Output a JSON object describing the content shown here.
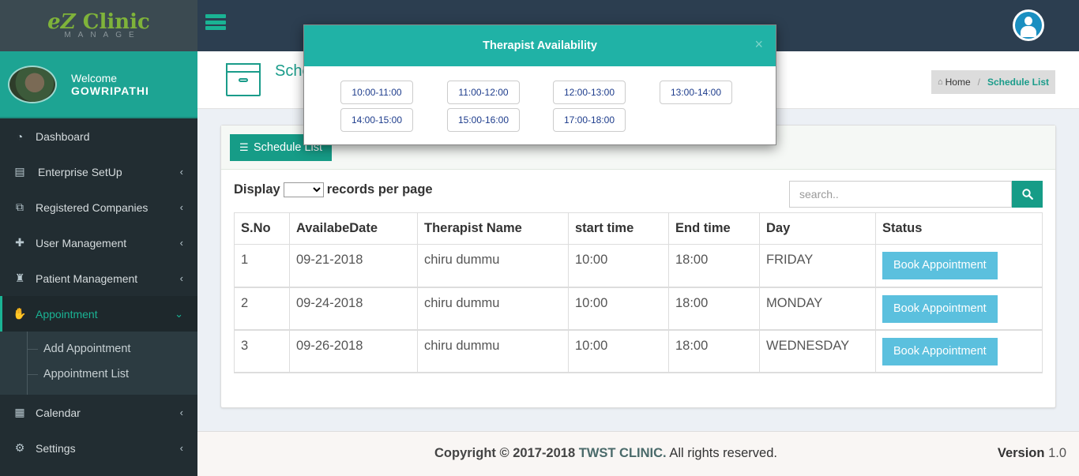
{
  "logo": {
    "name_prefix": "eZ",
    "name_suffix": " Clinic",
    "subtitle": "MANAGE"
  },
  "user_panel": {
    "welcome": "Welcome",
    "username": "GOWRIPATHI"
  },
  "sidebar": {
    "items": [
      {
        "label": "Dashboard",
        "icon": "dashboard-icon",
        "arrow": ""
      },
      {
        "label": "Enterprise SetUp",
        "icon": "clipboard-icon",
        "arrow": "‹"
      },
      {
        "label": "Registered Companies",
        "icon": "sitemap-icon",
        "arrow": "‹"
      },
      {
        "label": "User Management",
        "icon": "user-plus-icon",
        "arrow": "‹"
      },
      {
        "label": "Patient Management",
        "icon": "patient-icon",
        "arrow": "‹"
      },
      {
        "label": "Appointment",
        "icon": "handshake-icon",
        "arrow": "⌄"
      },
      {
        "label": "Calendar",
        "icon": "calendar-icon",
        "arrow": "‹"
      },
      {
        "label": "Settings",
        "icon": "gear-icon",
        "arrow": "‹"
      }
    ],
    "submenu": [
      "Add Appointment",
      "Appointment List"
    ]
  },
  "header": {
    "title": "Schedule List",
    "title_visible": "Sche"
  },
  "breadcrumb": {
    "home": "Home",
    "current": "Schedule List"
  },
  "panel": {
    "button_label": "Schedule List",
    "display_label": "Display",
    "records_label": "records per page",
    "search_placeholder": "search.."
  },
  "table": {
    "columns": [
      "S.No",
      "AvailabeDate",
      "Therapist Name",
      "start time",
      "End time",
      "Day",
      "Status"
    ],
    "rows": [
      {
        "sno": "1",
        "date": "09-21-2018",
        "therapist": "chiru dummu",
        "start": "10:00",
        "end": "18:00",
        "day": "FRIDAY",
        "status": "Book Appointment"
      },
      {
        "sno": "2",
        "date": "09-24-2018",
        "therapist": "chiru dummu",
        "start": "10:00",
        "end": "18:00",
        "day": "MONDAY",
        "status": "Book Appointment"
      },
      {
        "sno": "3",
        "date": "09-26-2018",
        "therapist": "chiru dummu",
        "start": "10:00",
        "end": "18:00",
        "day": "WEDNESDAY",
        "status": "Book Appointment"
      }
    ]
  },
  "footer": {
    "copyright_prefix": "Copyright © 2017-2018",
    "brand": "TWST CLINIC.",
    "rights": "All rights reserved.",
    "version_label": "Version",
    "version_value": "1.0"
  },
  "modal": {
    "title": "Therapist Availability",
    "close": "×",
    "slots": [
      "10:00-11:00",
      "11:00-12:00",
      "12:00-13:00",
      "13:00-14:00",
      "14:00-15:00",
      "15:00-16:00",
      "17:00-18:00"
    ]
  },
  "colors": {
    "accent": "#1ab394",
    "topbar": "#2c3e50",
    "sidebar": "#222d32",
    "book_button": "#5bc0de"
  }
}
